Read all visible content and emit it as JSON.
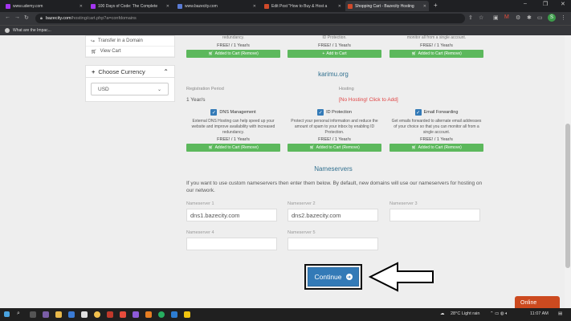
{
  "browser": {
    "tabs": [
      {
        "title": "www.udemy.com",
        "favicon_color": "#a435f0"
      },
      {
        "title": "100 Days of Code: The Complete",
        "favicon_color": "#a435f0"
      },
      {
        "title": "www.bazecity.com",
        "favicon_color": "#5a7bd4"
      },
      {
        "title": "Edit Post \"How to Buy & Host a",
        "favicon_color": "#d04a2a"
      },
      {
        "title": "Shopping Cart - Bazecity Hosting",
        "favicon_color": "#d04a2a"
      }
    ],
    "new_tab": "+",
    "url_host": "bazecity.com",
    "url_path": "/hosting/cart.php?a=confdomains",
    "bookmark": "What are the Impac..."
  },
  "sidebar": {
    "transfer_label": "Transfer in a Domain",
    "view_cart_label": "View Cart",
    "currency_heading": "Choose Currency",
    "currency_value": "USD"
  },
  "top_row": {
    "col1_title": "redundancy.",
    "col2_title": "ID Protection.",
    "col3_title": "monitor all from a single account.",
    "price": "FREE! / 1 Year/s",
    "col1_button": "Added to Cart (Remove)",
    "col2_button": "Add to Cart",
    "col3_button": "Added to Cart (Remove)"
  },
  "domain": {
    "name": "karimu.org",
    "reg_period_label": "Registration Period",
    "reg_period_value": "1 Year/s",
    "hosting_label": "Hosting",
    "hosting_value": "[No Hosting! Click to Add]"
  },
  "addons": [
    {
      "title": "DNS Management",
      "desc": "External DNS Hosting can help speed up your website and improve availability with increased redundancy.",
      "price": "FREE! / 1 Year/s",
      "button": "Added to Cart (Remove)"
    },
    {
      "title": "ID Protection",
      "desc": "Protect your personal information and reduce the amount of spam to your inbox by enabling ID Protection.",
      "price": "FREE! / 1 Year/s",
      "button": "Added to Cart (Remove)"
    },
    {
      "title": "Email Forwarding",
      "desc": "Get emails forwarded to alternate email addresses of your choice so that you can monitor all from a single account.",
      "price": "FREE! / 1 Year/s",
      "button": "Added to Cart (Remove)"
    }
  ],
  "nameservers": {
    "heading": "Nameservers",
    "text": "If you want to use custom nameservers then enter them below. By default, new domains will use our nameservers for hosting on our network.",
    "ns1_label": "Nameserver 1",
    "ns1_value": "dns1.bazecity.com",
    "ns2_label": "Nameserver 2",
    "ns2_value": "dns2.bazecity.com",
    "ns3_label": "Nameserver 3",
    "ns3_value": "",
    "ns4_label": "Nameserver 4",
    "ns4_value": "",
    "ns5_label": "Nameserver 5",
    "ns5_value": ""
  },
  "continue_label": "Continue",
  "chat_label": "Online",
  "taskbar": {
    "weather": "28°C  Light rain",
    "time": "11:07 AM"
  },
  "colors": {
    "accent_blue": "#337ab7",
    "green": "#5cb85c",
    "link_title": "#31708f",
    "warning_red": "#e04343",
    "chat_orange": "#cc4a1f"
  }
}
